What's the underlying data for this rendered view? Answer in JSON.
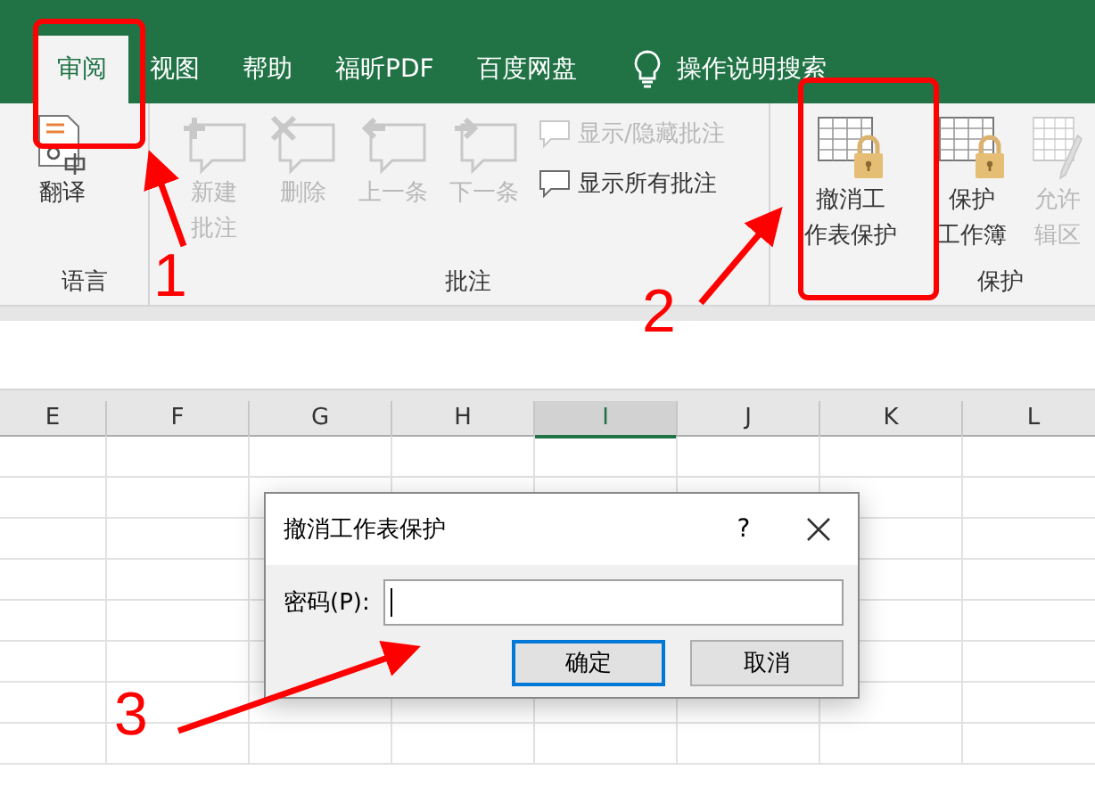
{
  "tabs": [
    {
      "label": "审阅",
      "selected": true
    },
    {
      "label": "视图",
      "selected": false
    },
    {
      "label": "帮助",
      "selected": false
    },
    {
      "label": "福昕PDF",
      "selected": false
    },
    {
      "label": "百度网盘",
      "selected": false
    }
  ],
  "search": {
    "label": "操作说明搜索"
  },
  "ribbon_groups": [
    {
      "label": "语言",
      "buttons": [
        {
          "kind": "large",
          "lines": [
            "翻译"
          ],
          "disabled": false
        }
      ]
    },
    {
      "label": "批注",
      "buttons": [
        {
          "kind": "large",
          "lines": [
            "新建",
            "批注"
          ],
          "disabled": true
        },
        {
          "kind": "large",
          "lines": [
            "删除"
          ],
          "disabled": true
        },
        {
          "kind": "large",
          "lines": [
            "上一条"
          ],
          "disabled": true
        },
        {
          "kind": "large",
          "lines": [
            "下一条"
          ],
          "disabled": true
        },
        {
          "kind": "small",
          "lines": [
            "显示/隐藏批注"
          ],
          "disabled": true
        },
        {
          "kind": "small",
          "lines": [
            "显示所有批注"
          ],
          "disabled": false
        }
      ]
    },
    {
      "label": "保护",
      "buttons": [
        {
          "kind": "large",
          "lines": [
            "撤消工",
            "作表保护"
          ],
          "disabled": false
        },
        {
          "kind": "large",
          "lines": [
            "保护",
            "工作簿"
          ],
          "disabled": false
        },
        {
          "kind": "large",
          "lines": [
            "允许",
            "辑区"
          ],
          "disabled": true
        }
      ]
    }
  ],
  "columns": [
    {
      "label": "E",
      "selected": false
    },
    {
      "label": "F",
      "selected": false
    },
    {
      "label": "G",
      "selected": false
    },
    {
      "label": "H",
      "selected": false
    },
    {
      "label": "I",
      "selected": true
    },
    {
      "label": "J",
      "selected": false
    },
    {
      "label": "K",
      "selected": false
    },
    {
      "label": "L",
      "selected": false
    }
  ],
  "dialog": {
    "title": "撤消工作表保护",
    "help": "?",
    "field_label": "密码(P):",
    "buttons": [
      {
        "label": "确定",
        "default": true
      },
      {
        "label": "取消",
        "default": false
      }
    ]
  },
  "annotation_numbers": [
    "1",
    "2",
    "3"
  ]
}
